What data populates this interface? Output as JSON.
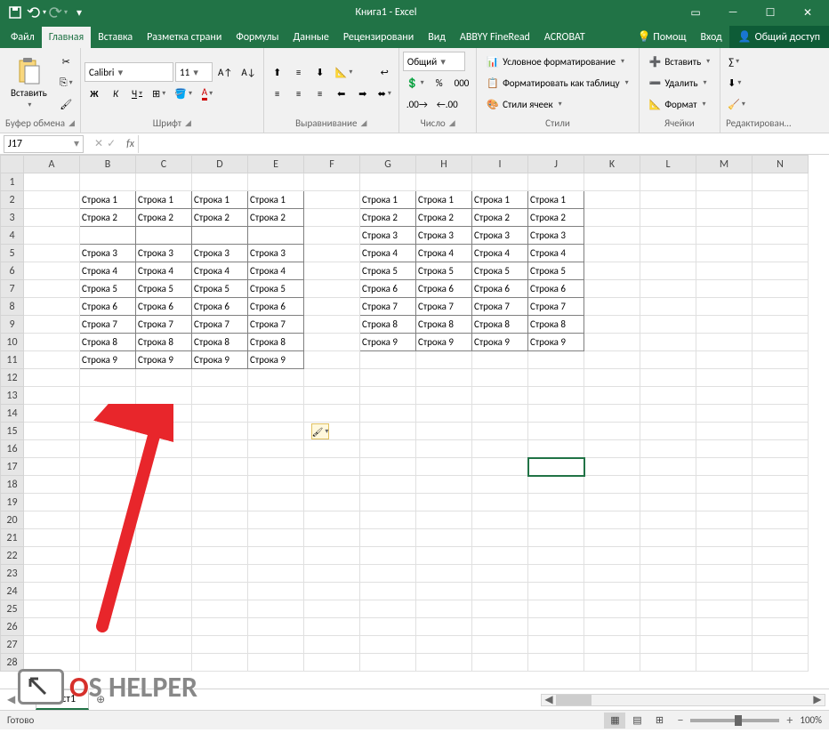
{
  "window": {
    "title": "Книга1 - Excel"
  },
  "tabs": {
    "file": "Файл",
    "home": "Главная",
    "insert": "Вставка",
    "layout": "Разметка страни",
    "formulas": "Формулы",
    "data": "Данные",
    "review": "Рецензировани",
    "view": "Вид",
    "abbyy": "ABBYY FineRead",
    "acrobat": "ACROBAT",
    "help": "Помощ",
    "login": "Вход",
    "share": "Общий доступ"
  },
  "ribbon": {
    "clipboard": {
      "label": "Буфер обмена",
      "paste": "Вставить"
    },
    "font": {
      "label": "Шрифт",
      "name": "Calibri",
      "size": "11",
      "bold": "Ж",
      "italic": "К",
      "underline": "Ч"
    },
    "align": {
      "label": "Выравнивание"
    },
    "number": {
      "label": "Число",
      "format": "Общий"
    },
    "styles": {
      "label": "Стили",
      "cond": "Условное форматирование",
      "table": "Форматировать как таблицу",
      "cell": "Стили ячеек"
    },
    "cells": {
      "label": "Ячейки",
      "insert": "Вставить",
      "delete": "Удалить",
      "format": "Формат"
    },
    "edit": {
      "label": "Редактирован…"
    }
  },
  "namebox": "J17",
  "columns": [
    "A",
    "B",
    "C",
    "D",
    "E",
    "F",
    "G",
    "H",
    "I",
    "J",
    "K",
    "L",
    "M",
    "N"
  ],
  "rows": 28,
  "table1": {
    "cols": [
      "B",
      "C",
      "D",
      "E"
    ],
    "startRow": 2,
    "values": [
      [
        "Строка 1",
        "Строка 1",
        "Строка 1",
        "Строка 1"
      ],
      [
        "Строка 2",
        "Строка 2",
        "Строка 2",
        "Строка 2"
      ],
      [
        "",
        "",
        "",
        ""
      ],
      [
        "Строка 3",
        "Строка 3",
        "Строка 3",
        "Строка 3"
      ],
      [
        "Строка 4",
        "Строка 4",
        "Строка 4",
        "Строка 4"
      ],
      [
        "Строка 5",
        "Строка 5",
        "Строка 5",
        "Строка 5"
      ],
      [
        "Строка 6",
        "Строка 6",
        "Строка 6",
        "Строка 6"
      ],
      [
        "Строка 7",
        "Строка 7",
        "Строка 7",
        "Строка 7"
      ],
      [
        "Строка 8",
        "Строка 8",
        "Строка 8",
        "Строка 8"
      ],
      [
        "Строка 9",
        "Строка 9",
        "Строка 9",
        "Строка 9"
      ]
    ]
  },
  "table2": {
    "cols": [
      "G",
      "H",
      "I",
      "J"
    ],
    "startRow": 2,
    "values": [
      [
        "Строка 1",
        "Строка 1",
        "Строка 1",
        "Строка 1"
      ],
      [
        "Строка 2",
        "Строка 2",
        "Строка 2",
        "Строка 2"
      ],
      [
        "Строка 3",
        "Строка 3",
        "Строка 3",
        "Строка 3"
      ],
      [
        "Строка 4",
        "Строка 4",
        "Строка 4",
        "Строка 4"
      ],
      [
        "Строка 5",
        "Строка 5",
        "Строка 5",
        "Строка 5"
      ],
      [
        "Строка 6",
        "Строка 6",
        "Строка 6",
        "Строка 6"
      ],
      [
        "Строка 7",
        "Строка 7",
        "Строка 7",
        "Строка 7"
      ],
      [
        "Строка 8",
        "Строка 8",
        "Строка 8",
        "Строка 8"
      ],
      [
        "Строка 9",
        "Строка 9",
        "Строка 9",
        "Строка 9"
      ]
    ]
  },
  "sheet": {
    "name": "Лист1"
  },
  "status": {
    "ready": "Готово",
    "zoom": "100%"
  }
}
